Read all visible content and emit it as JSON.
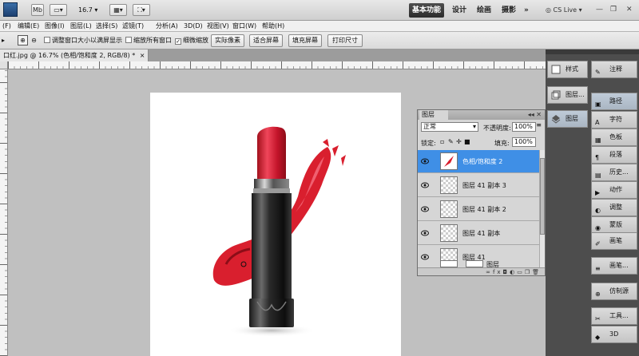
{
  "appbar": {
    "ps_label": "",
    "br_label": "Mb",
    "zoom": "16.7",
    "workspaces": {
      "active": "基本功能",
      "design": "设计",
      "painting": "绘画",
      "photography": "摄影",
      "more": "»"
    },
    "cslive": "CS Live"
  },
  "menu": {
    "items": [
      "(F)",
      "编辑(E)",
      "图像(I)",
      "图层(L)",
      "选择(S)",
      "滤镜(T)",
      "分析(A)",
      "3D(D)",
      "视图(V)",
      "窗口(W)",
      "帮助(H)"
    ]
  },
  "options": {
    "resize_windows": "调整窗口大小以满屏显示",
    "zoom_all": "缩放所有窗口",
    "scrubby_zoom": "细微缩放",
    "actual_pixels": "实际像素",
    "fit_screen": "适合屏幕",
    "fill_screen": "填充屏幕",
    "print_size": "打印尺寸"
  },
  "document": {
    "tab_title": "口红.jpg @ 16.7% (色相/饱和度 2, RGB/8) *",
    "tab_close": "×"
  },
  "layers_panel": {
    "tab": "图层",
    "blend_mode": "正常",
    "opacity_label": "不透明度:",
    "opacity": "100%",
    "lock_label": "锁定:",
    "fill_label": "填充:",
    "fill": "100%",
    "layers": [
      {
        "name": "色相/饱和度 2"
      },
      {
        "name": "图层 41 副本 3"
      },
      {
        "name": "图层 41 副本 2"
      },
      {
        "name": "图层 41 副本"
      },
      {
        "name": "图层 41"
      },
      {
        "name": "图层"
      }
    ]
  },
  "dock_col1": [
    "样式",
    "图层...",
    "图层"
  ],
  "dock_col2": [
    "注释",
    "路径",
    "字符",
    "色板",
    "段落",
    "历史...",
    "动作",
    "调整",
    "蒙版",
    "画笔",
    "画笔...",
    "仿制源",
    "工具...",
    "3D"
  ],
  "colors": {
    "selected_layer": "#3f8fe6",
    "lipstick_red": "#d91f2e",
    "panel_dark": "#4d4d4d"
  }
}
